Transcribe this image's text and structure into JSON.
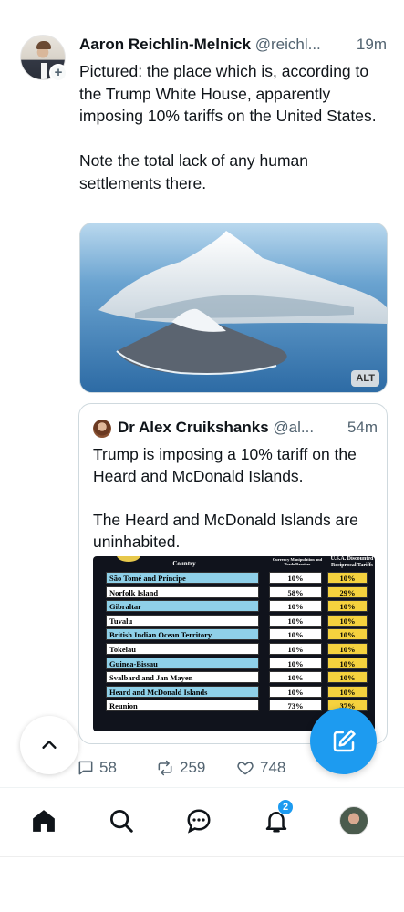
{
  "post": {
    "author_name": "Aaron Reichlin-Melnick",
    "handle": "@reichl...",
    "time": "19m",
    "text": "Pictured: the place which is, according to the Trump White House, apparently imposing 10% tariffs on the United States.\n\nNote the total lack of any human settlements there.",
    "media_alt_badge": "ALT",
    "follow_glyph": "+"
  },
  "quoted_post": {
    "author_name": "Dr Alex Cruikshanks",
    "handle": "@al...",
    "time": "54m",
    "text": "Trump is imposing a 10% tariff on the Heard and McDonald Islands.\n\nThe Heard and McDonald Islands are uninhabited.",
    "table": {
      "header_country": "Country",
      "header_currency": "Currency Manipulation and Trade Barriers",
      "header_reciprocal": "U.S.A. Discounted Reciprocal Tariffs",
      "rows": [
        {
          "country": "São Tomé and Príncipe",
          "currency": "10%",
          "reciprocal": "10%"
        },
        {
          "country": "Norfolk Island",
          "currency": "58%",
          "reciprocal": "29%"
        },
        {
          "country": "Gibraltar",
          "currency": "10%",
          "reciprocal": "10%"
        },
        {
          "country": "Tuvalu",
          "currency": "10%",
          "reciprocal": "10%"
        },
        {
          "country": "British Indian Ocean Territory",
          "currency": "10%",
          "reciprocal": "10%"
        },
        {
          "country": "Tokelau",
          "currency": "10%",
          "reciprocal": "10%"
        },
        {
          "country": "Guinea-Bissau",
          "currency": "10%",
          "reciprocal": "10%"
        },
        {
          "country": "Svalbard and Jan Mayen",
          "currency": "10%",
          "reciprocal": "10%"
        },
        {
          "country": "Heard and McDonald Islands",
          "currency": "10%",
          "reciprocal": "10%"
        },
        {
          "country": "Reunion",
          "currency": "73%",
          "reciprocal": "37%"
        }
      ]
    }
  },
  "actions": {
    "replies": "58",
    "reposts": "259",
    "likes": "748"
  },
  "nav": {
    "notifications_badge": "2"
  },
  "colors": {
    "accent": "#1d9bf0",
    "text_primary": "#0f1419",
    "text_secondary": "#536471",
    "table_blue_row": "#8fd0e8",
    "table_yellow_cell": "#f5d23e"
  },
  "icons": [
    "follow-plus-icon",
    "reply-icon",
    "repost-icon",
    "like-icon",
    "chevron-up-icon",
    "compose-icon",
    "home-icon",
    "search-icon",
    "grok-chat-icon",
    "bell-icon"
  ]
}
